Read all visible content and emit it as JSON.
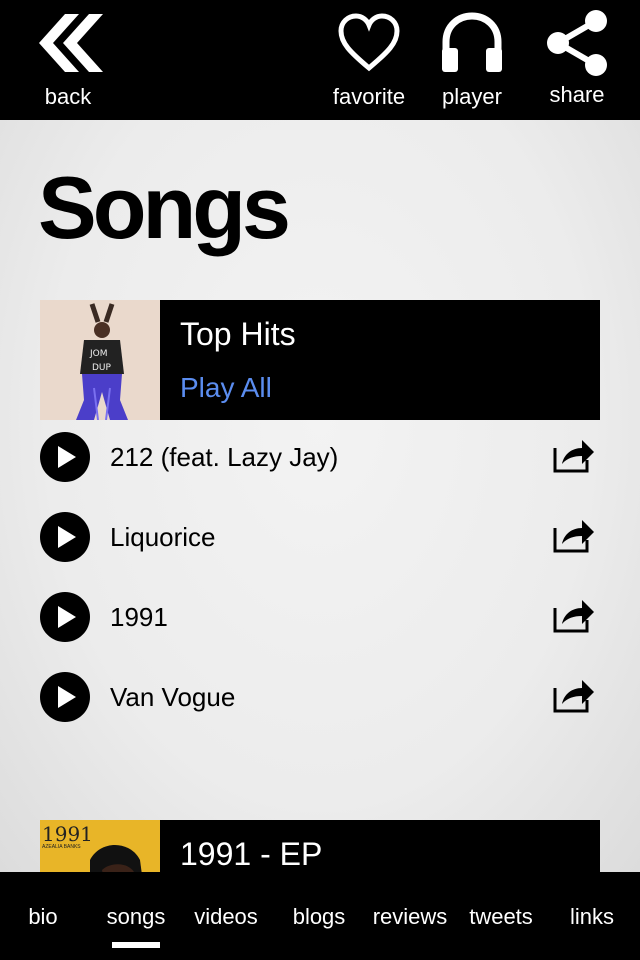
{
  "topbar": {
    "back": "back",
    "favorite": "favorite",
    "player": "player",
    "share": "share"
  },
  "page": {
    "title": "Songs"
  },
  "albums": [
    {
      "name": "Top Hits",
      "play_all": "Play All",
      "tracks": [
        "212 (feat. Lazy Jay)",
        "Liquorice",
        "1991",
        "Van Vogue"
      ]
    },
    {
      "name": "1991 - EP",
      "art_text": "1991",
      "art_subtext": "AZEALIA BANKS"
    }
  ],
  "bottom_nav": {
    "items": [
      "bio",
      "songs",
      "videos",
      "blogs",
      "reviews",
      "tweets",
      "links"
    ],
    "active": "songs"
  },
  "colors": {
    "accent": "#5b8df0",
    "bar": "#000000"
  },
  "icons": [
    "double-chevron-left-icon",
    "heart-icon",
    "headphones-icon",
    "share-icon",
    "play-icon",
    "share-arrow-icon"
  ]
}
